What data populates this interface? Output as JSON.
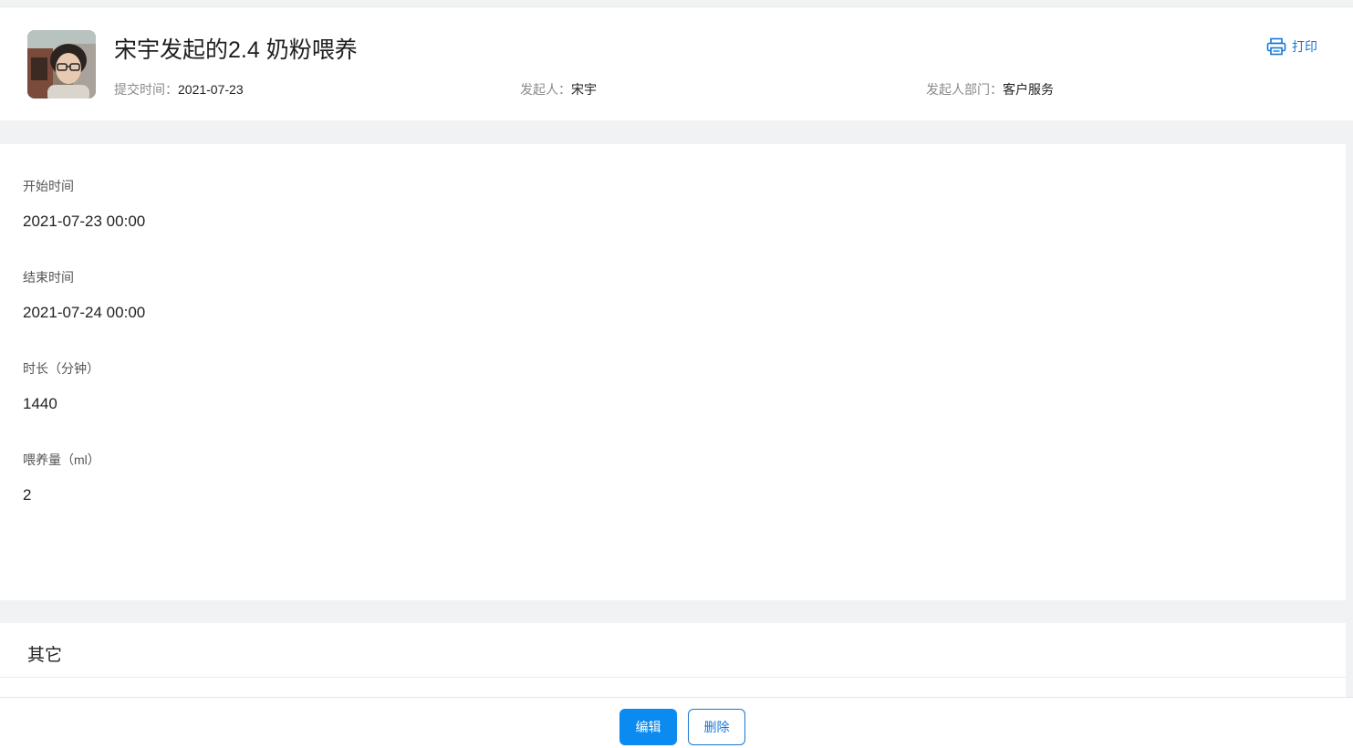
{
  "header": {
    "title": "宋宇发起的2.4 奶粉喂养",
    "submit_time_label": "提交时间：",
    "submit_time": "2021-07-23",
    "initiator_label": "发起人：",
    "initiator": "宋宇",
    "department_label": "发起人部门：",
    "department": "客户服务",
    "print_label": "打印"
  },
  "fields": [
    {
      "label": "开始时间",
      "value": "2021-07-23 00:00"
    },
    {
      "label": "结束时间",
      "value": "2021-07-24 00:00"
    },
    {
      "label": "时长（分钟）",
      "value": "1440"
    },
    {
      "label": "喂养量（ml）",
      "value": "2"
    }
  ],
  "other": {
    "title": "其它"
  },
  "footer": {
    "edit_label": "编辑",
    "delete_label": "删除"
  },
  "colors": {
    "accent": "#0b8bf0",
    "link": "#1677d2",
    "background": "#f1f2f4"
  }
}
